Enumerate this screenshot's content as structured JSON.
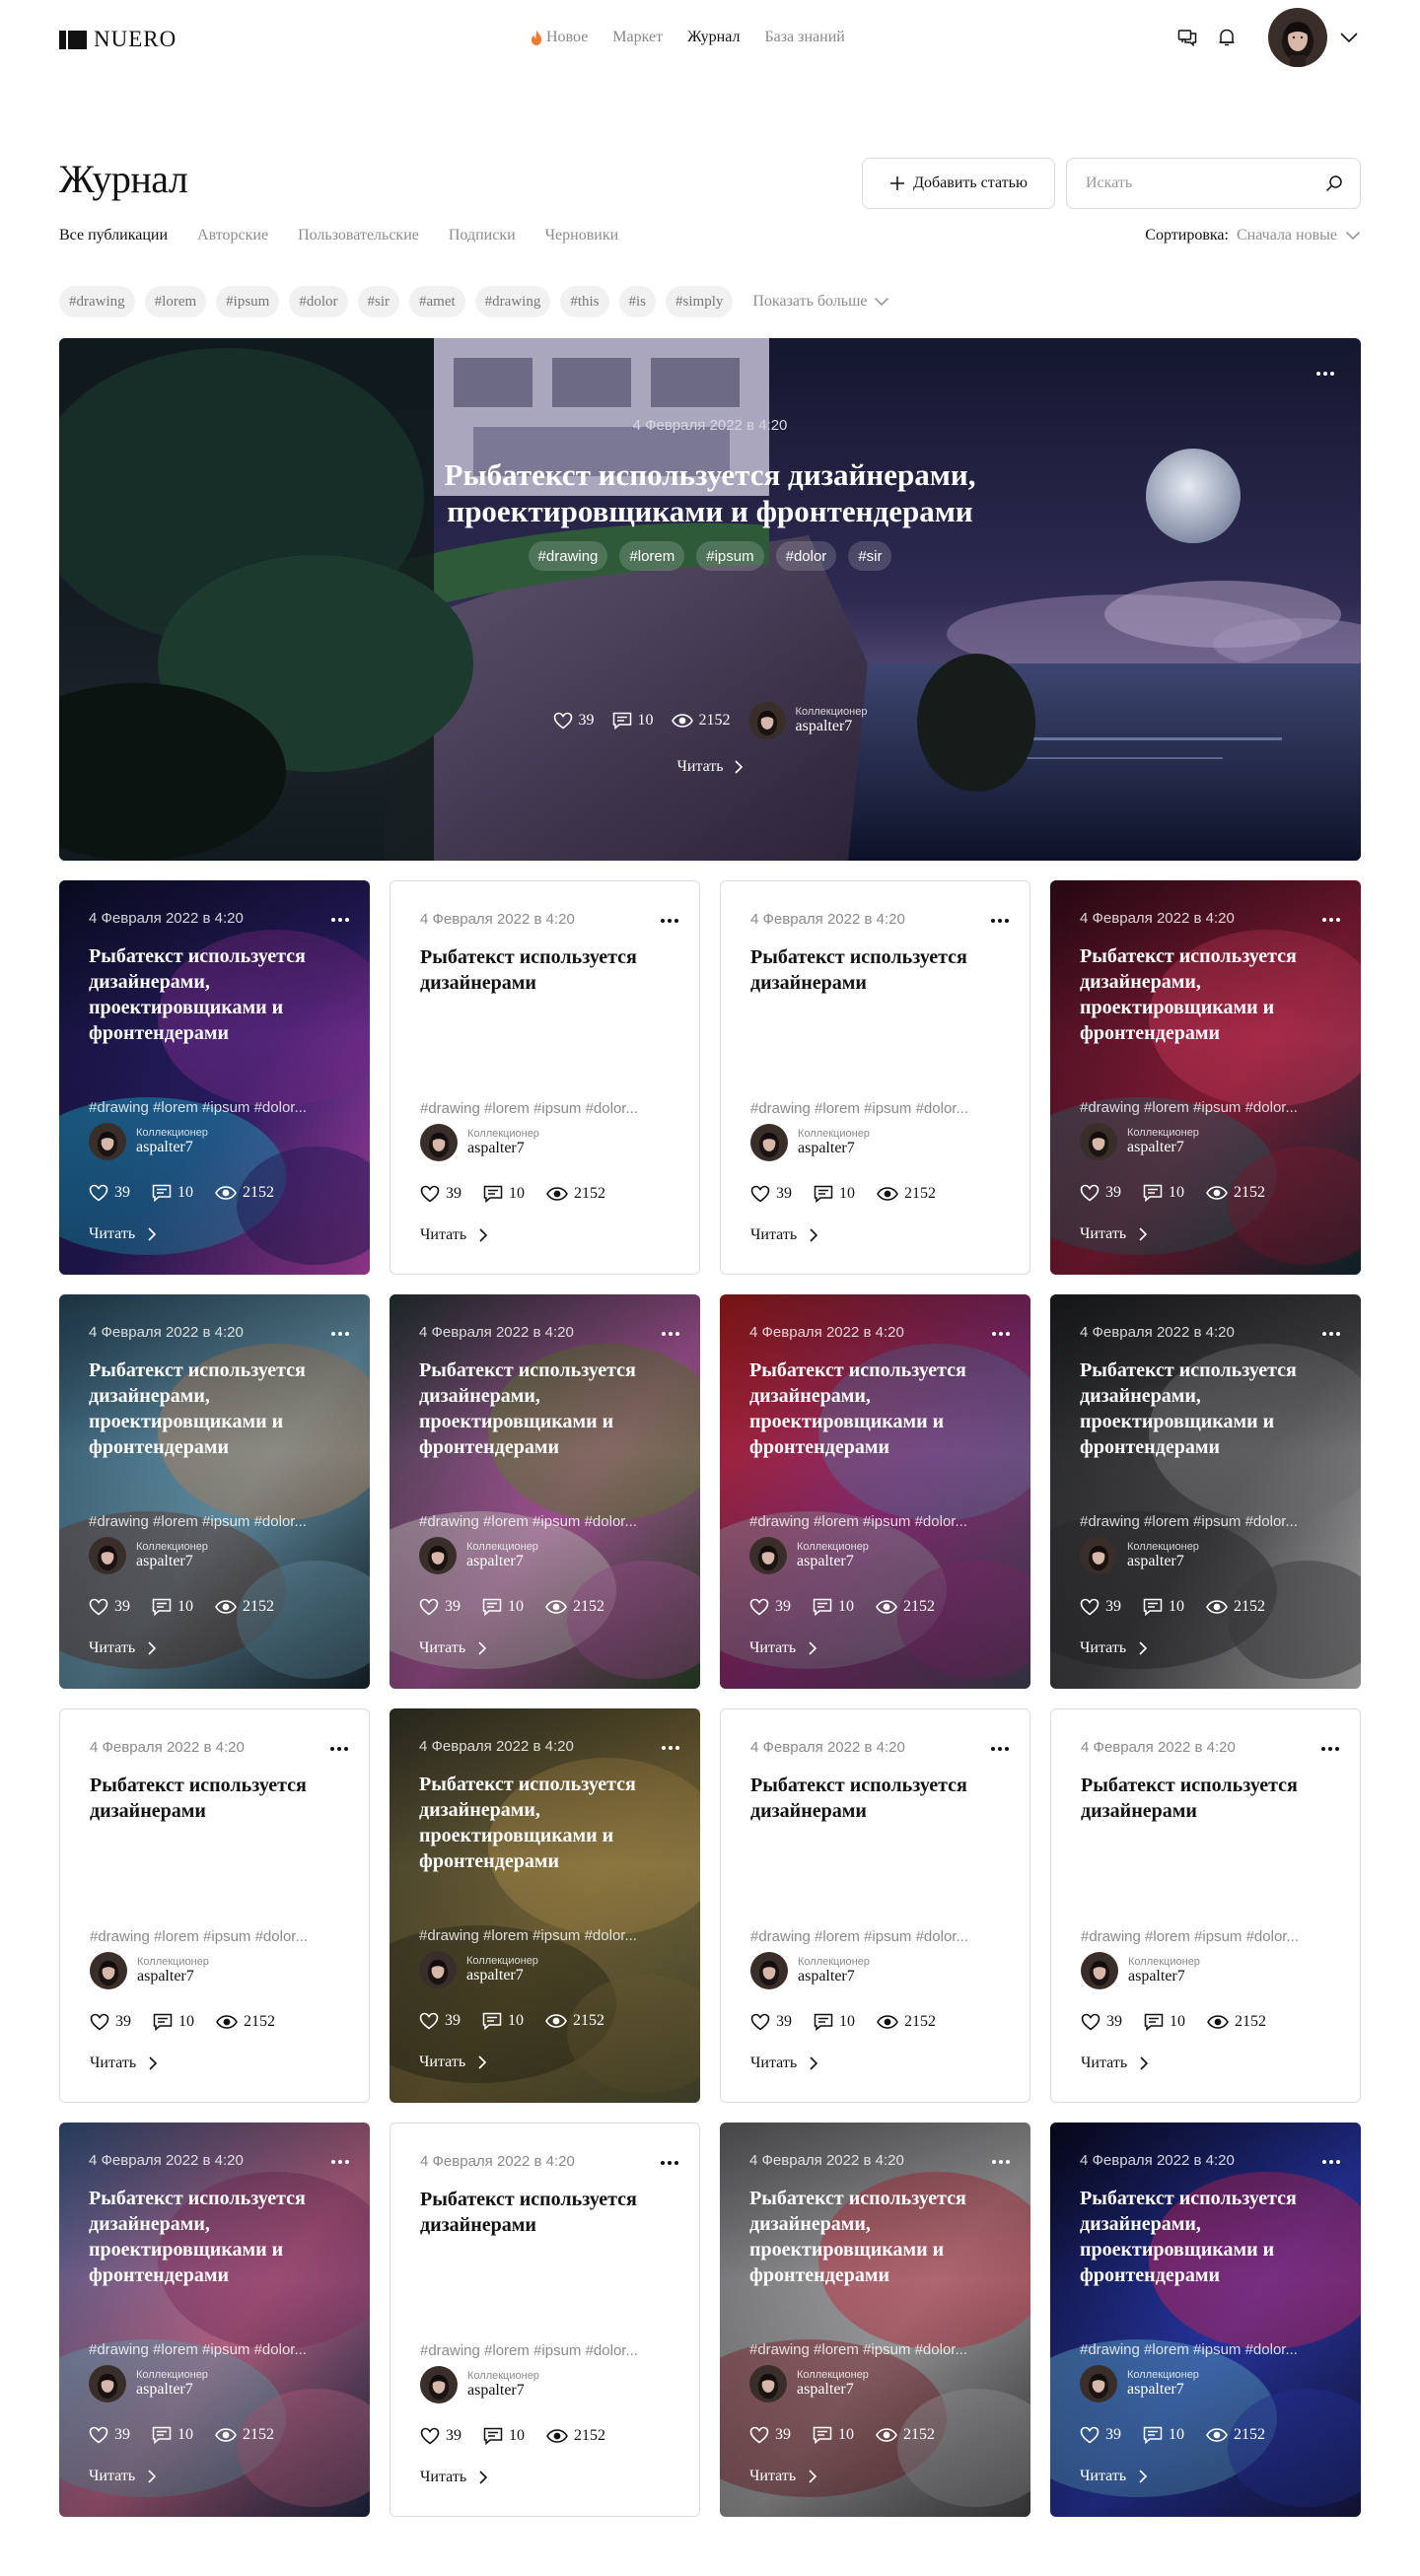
{
  "header": {
    "logo_text": "NUERO",
    "nav": [
      {
        "label": "Новое",
        "icon": "fire-icon",
        "active": false
      },
      {
        "label": "Маркет",
        "active": false
      },
      {
        "label": "Журнал",
        "active": true
      },
      {
        "label": "База знаний",
        "active": false
      }
    ],
    "icons": [
      "chat-icon",
      "bell-icon",
      "chevron-down-icon"
    ]
  },
  "page": {
    "title": "Журнал",
    "add_button": "Добавить статью",
    "search_placeholder": "Искать",
    "tabs": [
      "Все публикации",
      "Авторские",
      "Пользовательские",
      "Подписки",
      "Черновики"
    ],
    "sort_label": "Сортировка:",
    "sort_value": "Сначала новые",
    "tags": [
      "#drawing",
      "#lorem",
      "#ipsum",
      "#dolor",
      "#sir",
      "#amet",
      "#drawing",
      "#this",
      "#is",
      "#simply"
    ],
    "show_more": "Показать больше"
  },
  "hero": {
    "date": "4 Февраля 2022 в 4:20",
    "title_line1": "Рыбатекст используется дизайнерами,",
    "title_line2": "проектировщиками и фронтендерами",
    "tags": [
      "#drawing",
      "#lorem",
      "#ipsum",
      "#dolor",
      "#sir"
    ],
    "likes": "39",
    "comments": "10",
    "views": "2152",
    "author_role": "Коллекционер",
    "author_name": "aspalter7",
    "read": "Читать"
  },
  "card_common": {
    "date": "4 Февраля 2022 в 4:20",
    "title_long": "Рыбатекст используется дизайнерами, проектировщиками и фронтендерами",
    "title_short": "Рыбатекст используется дизайнерами",
    "tags": "#drawing  #lorem  #ipsum  #dolor...",
    "author_role": "Коллекционер",
    "author_name": "aspalter7",
    "likes": "39",
    "comments": "10",
    "views": "2152",
    "read": "Читать"
  },
  "cards": [
    {
      "style": "img",
      "theme": "neon-city"
    },
    {
      "style": "plain"
    },
    {
      "style": "plain"
    },
    {
      "style": "img",
      "theme": "crimson-flowers"
    },
    {
      "style": "img",
      "theme": "astronaut"
    },
    {
      "style": "img",
      "theme": "flower-car"
    },
    {
      "style": "img",
      "theme": "red-gradient"
    },
    {
      "style": "img",
      "theme": "storm-horse"
    },
    {
      "style": "plain"
    },
    {
      "style": "img",
      "theme": "forest-bear"
    },
    {
      "style": "plain"
    },
    {
      "style": "plain"
    },
    {
      "style": "img",
      "theme": "marble-pink"
    },
    {
      "style": "plain"
    },
    {
      "style": "img",
      "theme": "red-grass"
    },
    {
      "style": "img",
      "theme": "glass-shards"
    }
  ],
  "colors": {
    "text": "#111111",
    "muted": "#8a8a8a",
    "border": "#dcdcdc",
    "pill": "#f1f1f1",
    "fire": "#f07a2e"
  }
}
